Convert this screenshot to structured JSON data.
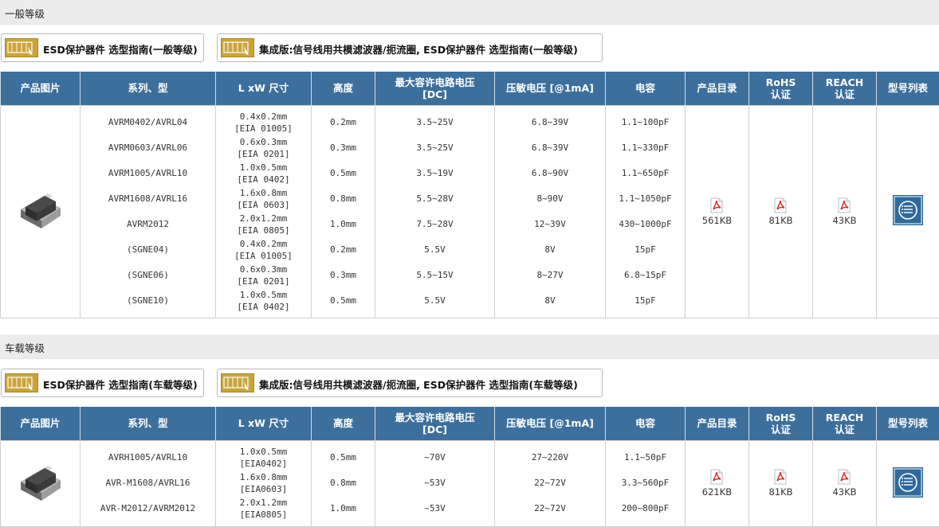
{
  "sections": [
    {
      "title": "一般等级",
      "guides": [
        {
          "label": "ESD保护器件 选型指南(一般等级)"
        },
        {
          "label": "集成版:信号线用共模滤波器/扼流圈, ESD保护器件 选型指南(一般等级)"
        }
      ],
      "headers": [
        "产品图片",
        "系列、型",
        "L xW 尺寸",
        "高度",
        "最大容许电路电压\n[DC]",
        "压敏电压 [@1mA]",
        "电容",
        "产品目录",
        "RoHS\n认证",
        "REACH\n认证",
        "型号列表"
      ],
      "rows": [
        {
          "series": "AVRM0402/AVRL04",
          "size1": "0.4x0.2mm",
          "size2": "[EIA 01005]",
          "height": "0.2mm",
          "voltage": "3.5~25V",
          "varistor": "6.8~39V",
          "capacitance": "1.1~100pF"
        },
        {
          "series": "AVRM0603/AVRL06",
          "size1": "0.6x0.3mm",
          "size2": "[EIA 0201]",
          "height": "0.3mm",
          "voltage": "3.5~25V",
          "varistor": "6.8~39V",
          "capacitance": "1.1~330pF"
        },
        {
          "series": "AVRM1005/AVRL10",
          "size1": "1.0x0.5mm",
          "size2": "[EIA 0402]",
          "height": "0.5mm",
          "voltage": "3.5~19V",
          "varistor": "6.8~90V",
          "capacitance": "1.1~650pF"
        },
        {
          "series": "AVRM1608/AVRL16",
          "size1": "1.6x0.8mm",
          "size2": "[EIA 0603]",
          "height": "0.8mm",
          "voltage": "5.5~28V",
          "varistor": "8~90V",
          "capacitance": "1.1~1050pF"
        },
        {
          "series": "AVRM2012",
          "size1": "2.0x1.2mm",
          "size2": "[EIA 0805]",
          "height": "1.0mm",
          "voltage": "7.5~28V",
          "varistor": "12~39V",
          "capacitance": "430~1000pF"
        },
        {
          "series": "(SGNE04)",
          "size1": "0.4x0.2mm",
          "size2": "[EIA 01005]",
          "height": "0.2mm",
          "voltage": "5.5V",
          "varistor": "8V",
          "capacitance": "15pF"
        },
        {
          "series": "(SGNE06)",
          "size1": "0.6x0.3mm",
          "size2": "[EIA 0201]",
          "height": "0.3mm",
          "voltage": "5.5~15V",
          "varistor": "8~27V",
          "capacitance": "6.8~15pF"
        },
        {
          "series": "(SGNE10)",
          "size1": "1.0x0.5mm",
          "size2": "[EIA 0402]",
          "height": "0.5mm",
          "voltage": "5.5V",
          "varistor": "8V",
          "capacitance": "15pF"
        }
      ],
      "catalog_size": "561KB",
      "rohs_size": "81KB",
      "reach_size": "43KB"
    },
    {
      "title": "车载等级",
      "guides": [
        {
          "label": "ESD保护器件 选型指南(车载等级)"
        },
        {
          "label": "集成版:信号线用共模滤波器/扼流圈, ESD保护器件 选型指南(车载等级)"
        }
      ],
      "headers": [
        "产品图片",
        "系列、型",
        "L xW 尺寸",
        "高度",
        "最大容许电路电压\n[DC]",
        "压敏电压 [@1mA]",
        "电容",
        "产品目录",
        "RoHS\n认证",
        "REACH\n认证",
        "型号列表"
      ],
      "rows": [
        {
          "series": "AVRH1005/AVRL10",
          "size1": "1.0x0.5mm",
          "size2": "[EIA0402]",
          "height": "0.5mm",
          "voltage": "~70V",
          "varistor": "27~220V",
          "capacitance": "1.1~50pF"
        },
        {
          "series": "AVR-M1608/AVRL16",
          "size1": "1.6x0.8mm",
          "size2": "[EIA0603]",
          "height": "0.8mm",
          "voltage": "~53V",
          "varistor": "22~72V",
          "capacitance": "3.3~560pF"
        },
        {
          "series": "AVR-M2012/AVRM2012",
          "size1": "2.0x1.2mm",
          "size2": "[EIA0805]",
          "height": "1.0mm",
          "voltage": "~53V",
          "varistor": "22~72V",
          "capacitance": "200~800pF"
        }
      ],
      "catalog_size": "621KB",
      "rohs_size": "81KB",
      "reach_size": "43KB"
    }
  ],
  "icons": {
    "guide": "guide-book-icon",
    "pdf": "pdf-icon",
    "list": "model-list-icon",
    "chip": "chip-varistor-image"
  },
  "colors": {
    "header_bg": "#3c6f9c",
    "guide_icon": "#c9a43a",
    "pdf_red": "#cc2a2a",
    "list_icon": "#2f6a9a"
  }
}
